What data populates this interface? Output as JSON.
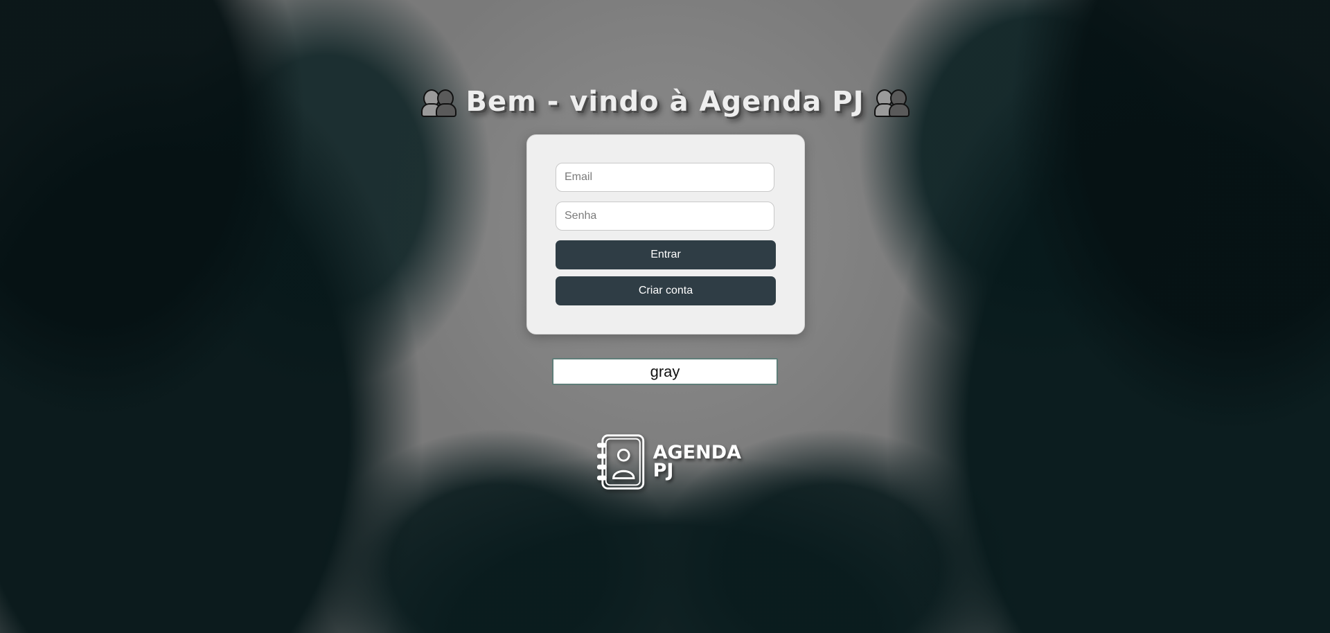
{
  "header": {
    "title": "Bem - vindo à Agenda PJ",
    "left_icon": "people-icon",
    "right_icon": "people-icon"
  },
  "login_form": {
    "email_placeholder": "Email",
    "email_value": "",
    "password_placeholder": "Senha",
    "password_value": "",
    "login_button": "Entrar",
    "create_account_button": "Criar conta"
  },
  "color_input": {
    "value": "gray"
  },
  "logo": {
    "line1": "AGENDA",
    "line2": "PJ",
    "icon": "contact-book-icon"
  },
  "colors": {
    "background": "#838383",
    "card": "#efefef",
    "button": "#2f3d45",
    "button_text": "#ffffff"
  }
}
